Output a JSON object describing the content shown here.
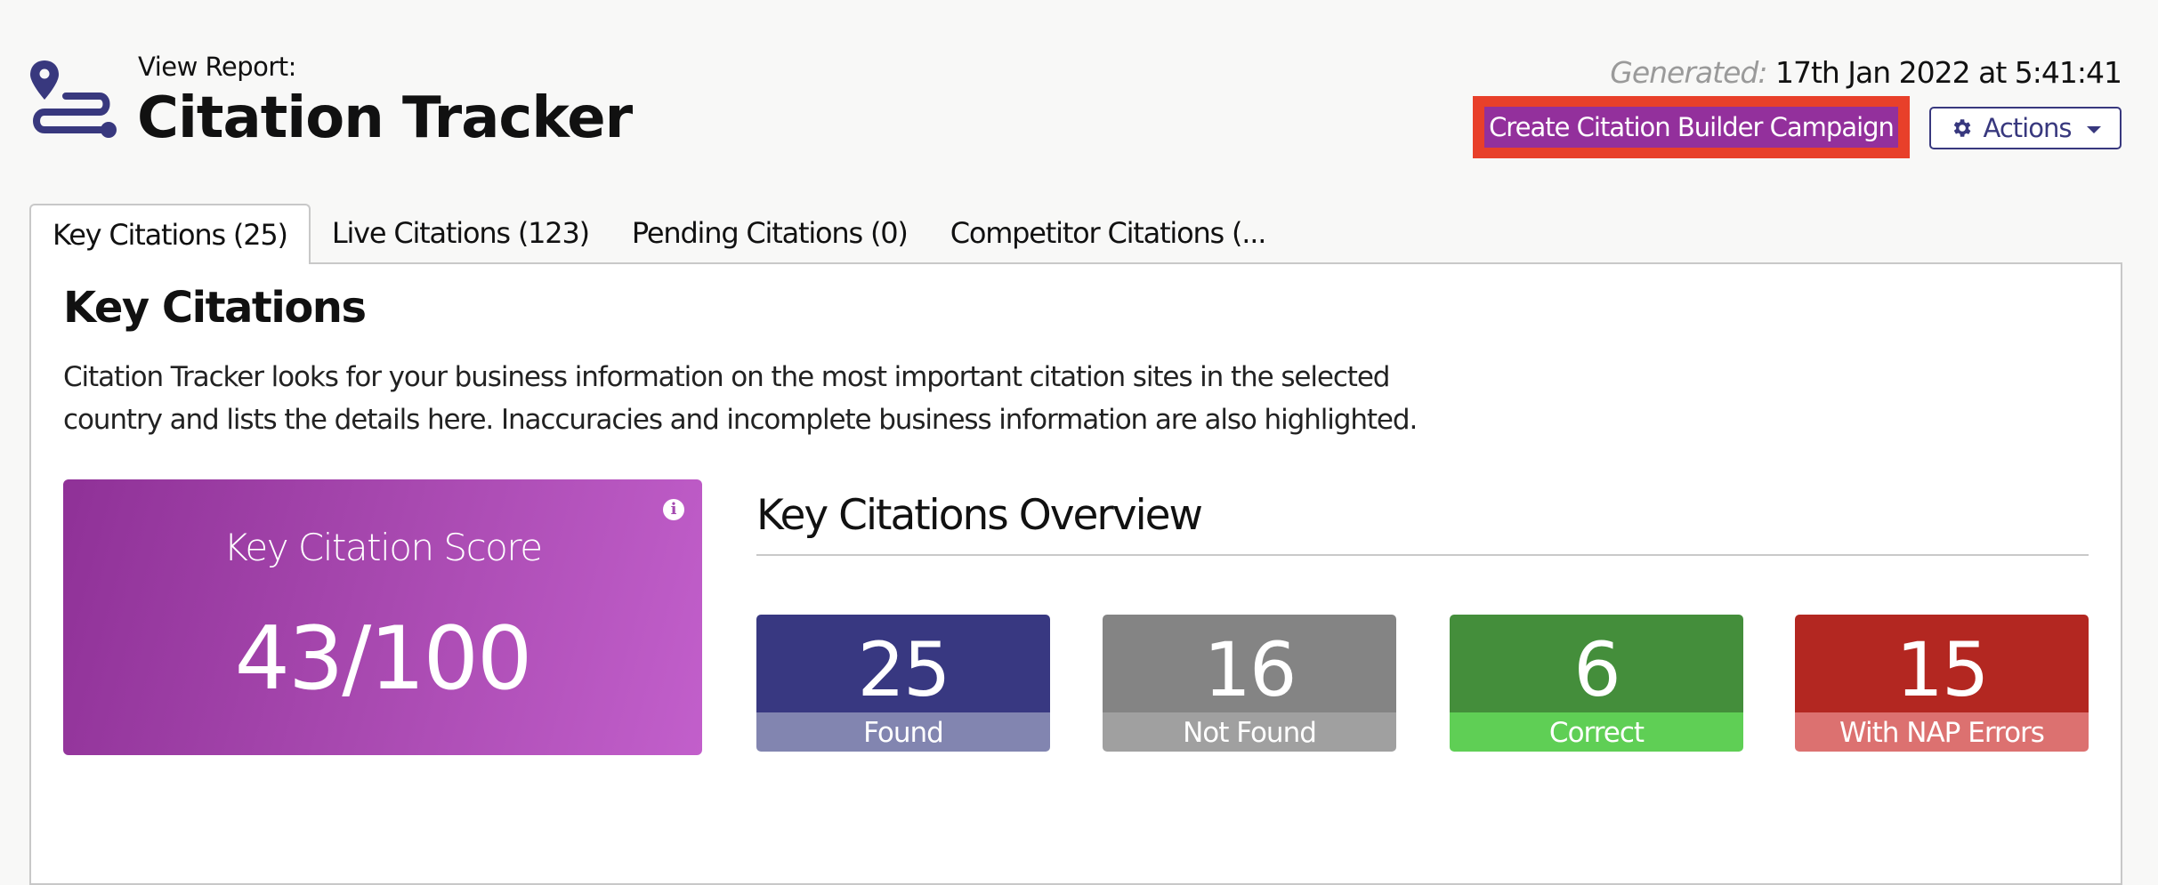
{
  "header": {
    "pre_title": "View Report:",
    "title": "Citation Tracker",
    "generated_label": "Generated:",
    "generated_value": "17th Jan 2022 at 5:41:41",
    "cta_label": "Create Citation Builder Campaign",
    "actions_label": "Actions",
    "brand_color": "#38387e",
    "cta_color": "#93309c",
    "highlight_color": "#e8402a"
  },
  "tabs": [
    {
      "label": "Key Citations (25)",
      "active": true
    },
    {
      "label": "Live Citations (123)",
      "active": false
    },
    {
      "label": "Pending Citations (0)",
      "active": false
    },
    {
      "label": "Competitor Citations (...",
      "active": false
    }
  ],
  "section": {
    "heading": "Key Citations",
    "description": "Citation Tracker looks for your business information on the most important citation sites in the selected country and lists the details here. Inaccuracies and incomplete business information are also highlighted."
  },
  "score_card": {
    "label": "Key Citation Score",
    "value": "43/100",
    "info_icon": "info-icon"
  },
  "overview": {
    "title": "Key Citations Overview",
    "stats": [
      {
        "value": "25",
        "label": "Found",
        "color_top": "#383881",
        "color_bottom": "#8285b0"
      },
      {
        "value": "16",
        "label": "Not Found",
        "color_top": "#848484",
        "color_bottom": "#a0a0a0"
      },
      {
        "value": "6",
        "label": "Correct",
        "color_top": "#448e3b",
        "color_bottom": "#5fcf55"
      },
      {
        "value": "15",
        "label": "With NAP Errors",
        "color_top": "#b32721",
        "color_bottom": "#dc7170"
      }
    ]
  }
}
